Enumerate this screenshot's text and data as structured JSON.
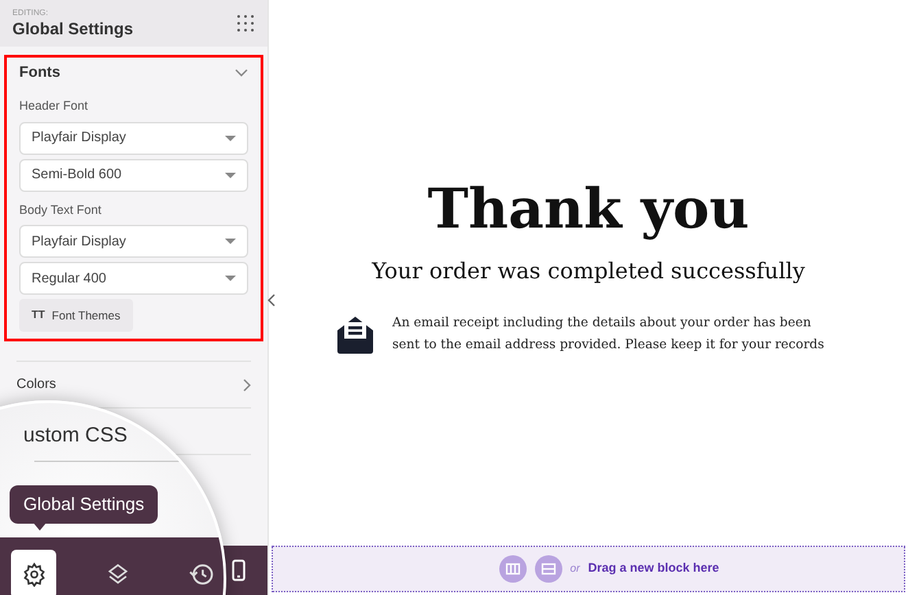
{
  "sidebar": {
    "editing_label": "EDITING:",
    "title": "Global Settings",
    "fonts_panel": {
      "label": "Fonts",
      "expanded": true,
      "highlighted": true,
      "groups": [
        {
          "label": "Header Font",
          "selects": [
            "Playfair Display",
            "Semi-Bold 600"
          ]
        },
        {
          "label": "Body Text Font",
          "selects": [
            "Playfair Display",
            "Regular 400"
          ]
        }
      ],
      "button_icon": "TT",
      "button": "Font Themes"
    },
    "sections": [
      {
        "label": "Colors",
        "expanded": false
      },
      {
        "expanded": false
      },
      {
        "expanded": false
      }
    ],
    "toolbar": [
      {
        "kind": "mobile",
        "selected": false
      }
    ]
  },
  "magnifier": {
    "partial_text": "ustom CSS",
    "tooltip": "Global Settings",
    "toolbar": [
      {
        "kind": "gear",
        "selected": true
      },
      {
        "kind": "layers",
        "selected": false
      },
      {
        "kind": "history",
        "selected": false
      }
    ]
  },
  "canvas": {
    "heading": "Thank you",
    "subheading": "Your order was completed successfully",
    "message": "An email receipt including the details about your order has been sent to the email address provided. Please keep it for your records",
    "drop_zone": {
      "or": "or",
      "label": "Drag a new block here"
    }
  }
}
